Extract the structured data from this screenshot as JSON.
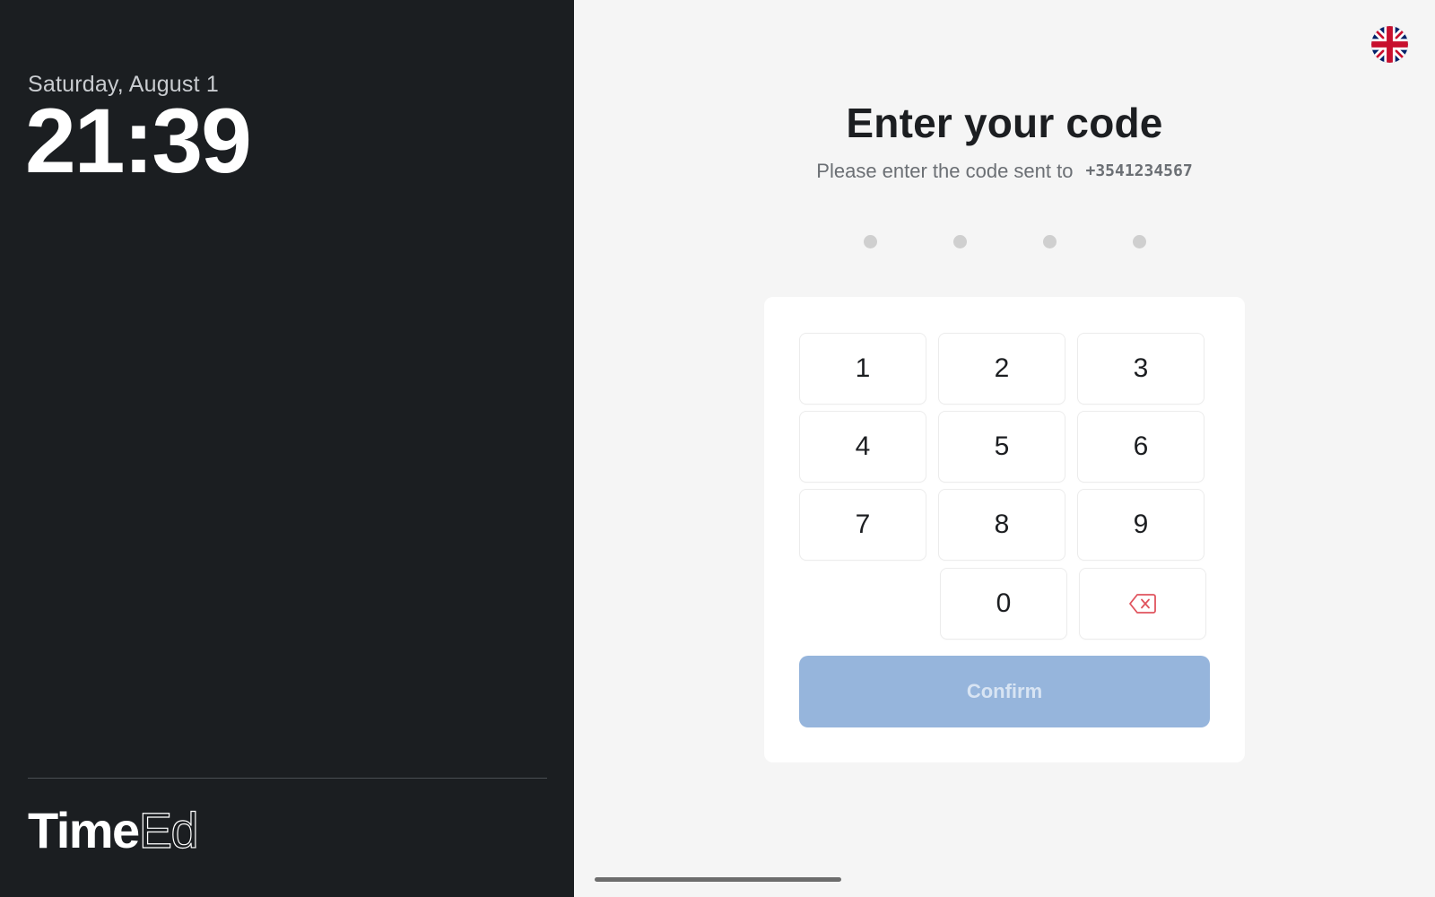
{
  "sidebar": {
    "date": "Saturday, August 1",
    "time": "21:39",
    "logo": {
      "part1": "Time",
      "part2": "Ed"
    }
  },
  "header": {
    "language_icon": "uk-flag-icon",
    "language": "English (UK)"
  },
  "main": {
    "title": "Enter your code",
    "subtitle": "Please enter the code sent to",
    "phone": "+3541234567",
    "code_length": 4,
    "entered_digits": 0
  },
  "keypad": {
    "keys": [
      "1",
      "2",
      "3",
      "4",
      "5",
      "6",
      "7",
      "8",
      "9",
      "0"
    ],
    "backspace_icon": "backspace-icon"
  },
  "confirm": {
    "label": "Confirm",
    "enabled": false
  },
  "colors": {
    "sidebar_bg": "#1b1e21",
    "main_bg": "#f5f5f5",
    "confirm_disabled": "#96b5dc",
    "backspace": "#e0545e",
    "dot_empty": "#cfcfcf"
  }
}
